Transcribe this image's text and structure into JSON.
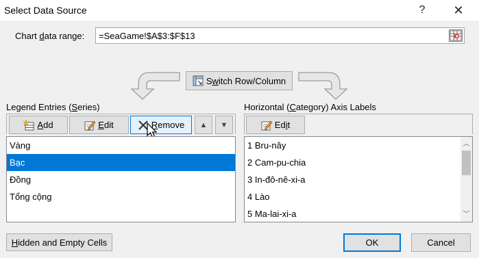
{
  "window": {
    "title": "Select Data Source",
    "help_glyph": "?",
    "close_glyph": "✕"
  },
  "range": {
    "label_pre": "Chart ",
    "label_u": "d",
    "label_post": "ata range:",
    "value": "=SeaGame!$A$3:$F$13"
  },
  "switch_button": {
    "pre": "S",
    "u": "w",
    "post": "itch Row/Column"
  },
  "legend": {
    "label_pre": "Legend Entries (",
    "label_u": "S",
    "label_post": "eries)",
    "add": {
      "u": "A",
      "rest": "dd"
    },
    "edit": {
      "u": "E",
      "rest": "dit"
    },
    "remove": {
      "u": "R",
      "rest": "emove"
    },
    "up_glyph": "▲",
    "down_glyph": "▼",
    "items": [
      "Vàng",
      "Bạc",
      "Đồng",
      "Tổng cộng"
    ],
    "selected_index": 1
  },
  "axis": {
    "label_pre": "Horizontal (",
    "label_u": "C",
    "label_post": "ategory) Axis Labels",
    "edit": {
      "pre": "Ed",
      "u": "i",
      "post": "t"
    },
    "items": [
      "1 Bru-nây",
      "2 Cam-pu-chia",
      "3 In-đô-nê-xi-a",
      "4 Lào",
      "5 Ma-lai-xi-a"
    ]
  },
  "footer": {
    "hidden_pre": "",
    "hidden_u": "H",
    "hidden_post": "idden and Empty Cells",
    "ok": "OK",
    "cancel": "Cancel"
  },
  "colors": {
    "selection": "#0078d7",
    "dialog_bg": "#f0f0f0",
    "button_bg": "#e1e1e1"
  }
}
